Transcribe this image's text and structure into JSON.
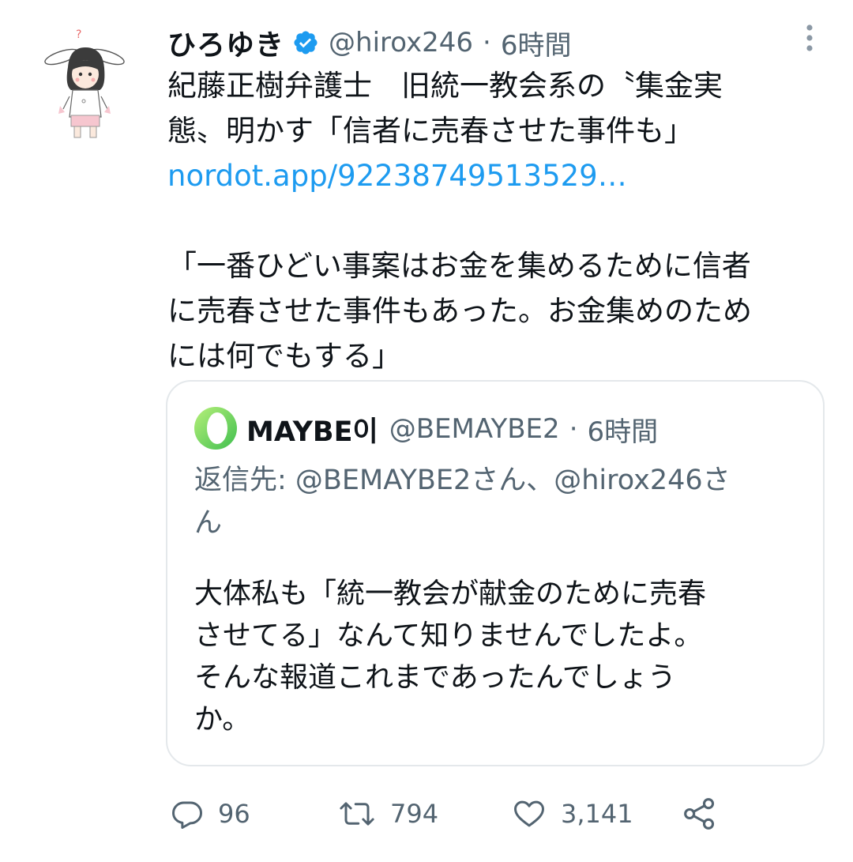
{
  "tweet": {
    "display_name": "ひろゆき",
    "handle": "@hirox246",
    "separator": "·",
    "time": "6時間",
    "avatar_icon": "avatar-anime-character",
    "verified_icon": "verified-badge-icon",
    "more_icon": "more-vertical-icon",
    "body_lines": [
      "紀藤正樹弁護士　旧統一教会系の〝集金実",
      "態〟明かす「信者に売春させた事件も」"
    ],
    "link": "nordot.app/92238749513529…",
    "quote_lines": [
      "「一番ひどい事案はお金を集めるために信者",
      "に売春させた事件もあった。お金集めのため",
      "には何でもする」"
    ]
  },
  "quoted": {
    "display_name": "MAYBE이",
    "handle": "@BEMAYBE2",
    "separator": "·",
    "time": "6時間",
    "reply_to_lines": [
      "返信先: @BEMAYBE2さん、@hirox246さ",
      "ん"
    ],
    "text_lines": [
      "大体私も「統一教会が献金のために売春",
      "させてる」なんて知りませんでしたよ。",
      "そんな報道これまであったんでしょう",
      "か。"
    ]
  },
  "actions": {
    "reply": {
      "icon": "reply-icon",
      "count": "96"
    },
    "retweet": {
      "icon": "retweet-icon",
      "count": "794"
    },
    "like": {
      "icon": "like-heart-icon",
      "count": "3,141"
    },
    "share": {
      "icon": "share-icon"
    }
  },
  "colors": {
    "link": "#1d9bf0",
    "secondary_text": "#536471",
    "primary_text": "#0f1419",
    "card_border": "#e4e8eb",
    "verified": "#1d9bf0",
    "quoted_avatar_green": "#7ed957"
  }
}
